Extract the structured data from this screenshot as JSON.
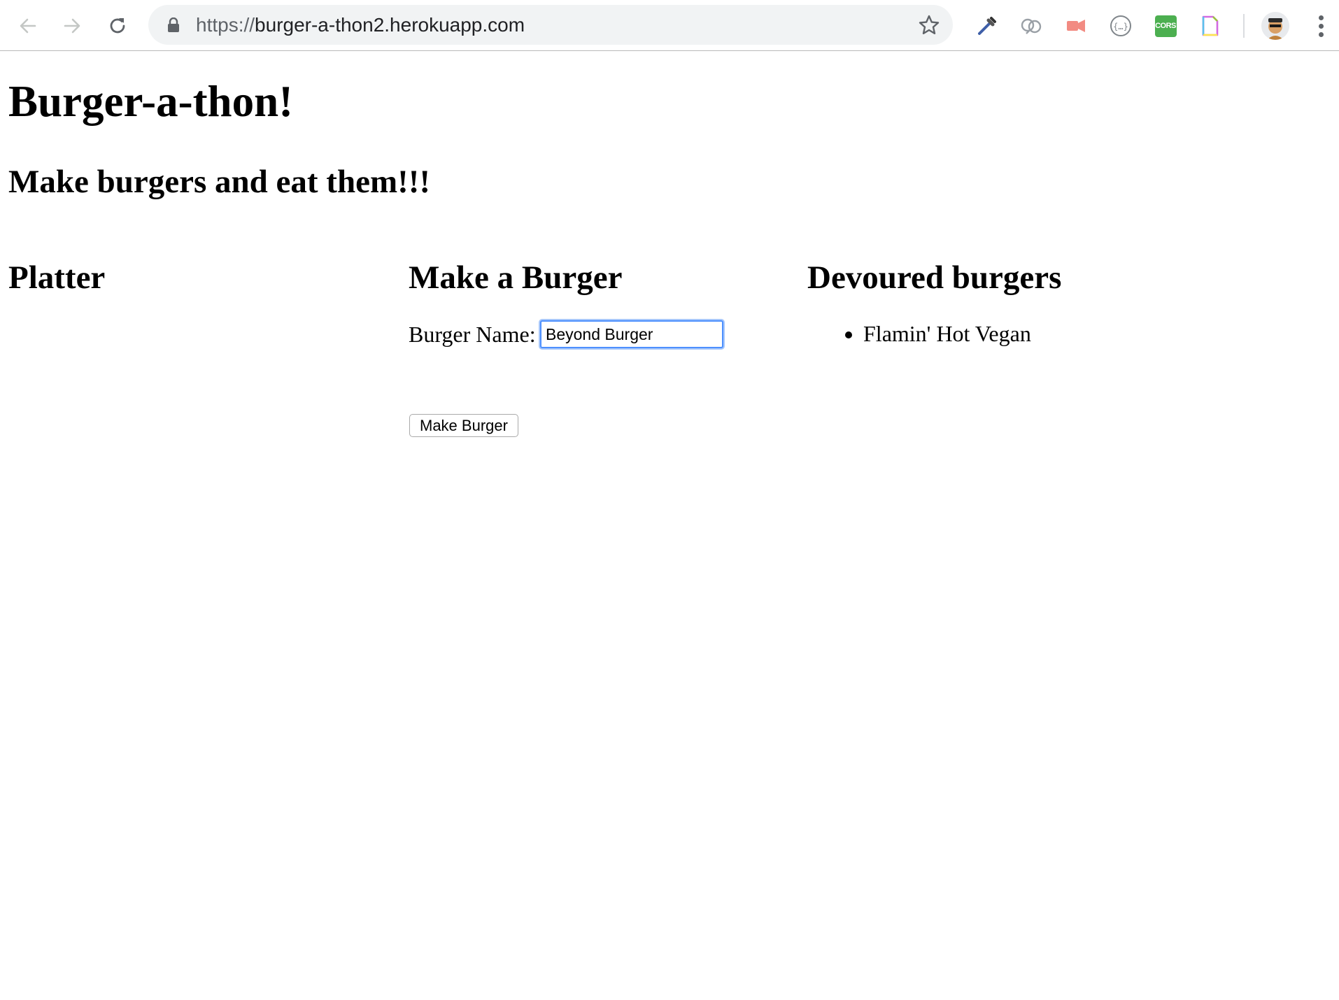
{
  "browser": {
    "url_scheme": "https://",
    "url_host": "burger-a-thon2.herokuapp.com",
    "extensions": [
      {
        "name": "eyedropper-extension-icon"
      },
      {
        "name": "mobile-extension-icon"
      },
      {
        "name": "video-extension-icon"
      },
      {
        "name": "json-formatter-extension-icon"
      },
      {
        "name": "cors-extension-icon",
        "label": "CORS"
      },
      {
        "name": "notes-extension-icon"
      }
    ],
    "accent_color": "#4d90fe"
  },
  "page": {
    "title": "Burger-a-thon!",
    "tagline": "Make burgers and eat them!!!",
    "platter": {
      "heading": "Platter",
      "items": []
    },
    "make": {
      "heading": "Make a Burger",
      "label": "Burger Name:",
      "input_value": "Beyond Burger",
      "button_label": "Make Burger"
    },
    "devoured": {
      "heading": "Devoured burgers",
      "items": [
        "Flamin' Hot Vegan"
      ]
    }
  }
}
